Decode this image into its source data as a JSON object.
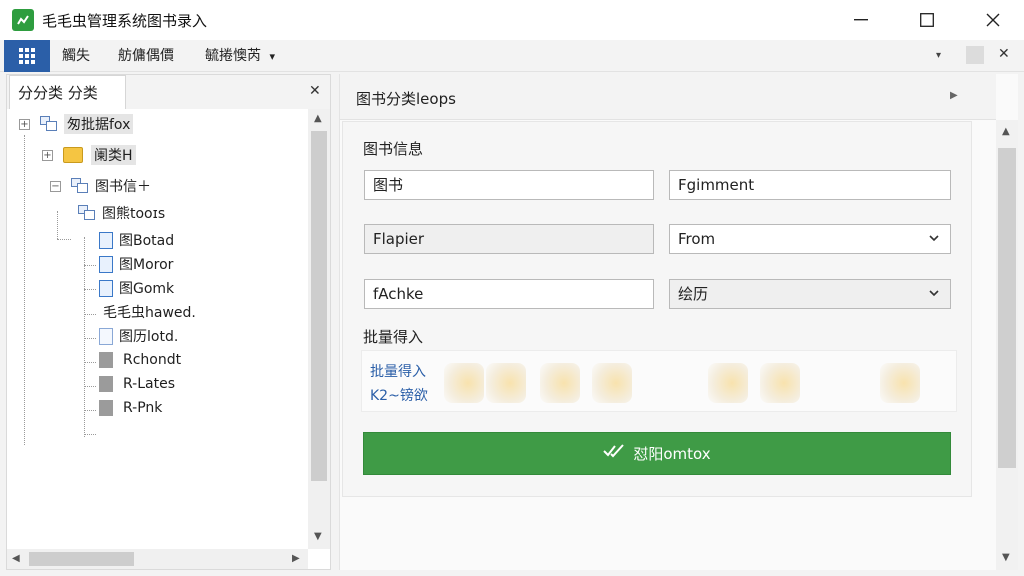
{
  "window": {
    "title": "毛毛虫管理系统图书录入",
    "minimize": "—",
    "maximize": "☐",
    "close": "✕"
  },
  "menubar": {
    "items": [
      {
        "label": "觸失"
      },
      {
        "label": "舫傭偶價"
      },
      {
        "label": "毓捲懊芮",
        "has_dropdown": true
      }
    ],
    "dropdown_arrow": "▾"
  },
  "left_panel": {
    "tab_label": "分分类  分类",
    "close": "✕",
    "tree": [
      {
        "label": "匆批据fox"
      },
      {
        "label": "阑类H"
      },
      {
        "label": "图书信＋"
      },
      {
        "label": "图熊tooɪs"
      },
      {
        "label": "图Botad"
      },
      {
        "label": "图Moror"
      },
      {
        "label": "图Gomk"
      },
      {
        "label": "毛毛虫hawed."
      },
      {
        "label": "图历lotd."
      },
      {
        "label": "Rchondt"
      },
      {
        "label": "R-Lates"
      },
      {
        "label": "R-Pnk"
      }
    ]
  },
  "right_panel": {
    "header_title": "图书分类leops",
    "section_info": "图书信息",
    "fields": {
      "title_input": "图书",
      "author_input": "Fgimment",
      "chapter_field": "Flapier",
      "from_select": "From",
      "fachke_input": "fAchke",
      "status_select": "绘历"
    },
    "section_batch": "批量得入",
    "batch_links": [
      "批量得入",
      "K2~镑欲"
    ],
    "submit_label": "怼阳omtox"
  },
  "colors": {
    "accent_blue": "#2b5fa8",
    "submit_green": "#3f9b46",
    "app_icon_green": "#2e9d3f"
  }
}
